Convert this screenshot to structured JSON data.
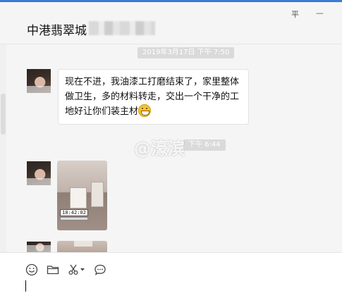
{
  "header": {
    "title": "中港翡翠城",
    "pin_label": "平",
    "minimize_label": "—"
  },
  "messages": [
    {
      "timestamp": "2019年3月17日 下午 7:50",
      "text": "现在不进，我油漆工打磨结束了，家里整体做卫生，多的材料转走，交出一个干净的工地好让你们装主材",
      "emoji": "grin-icon"
    },
    {
      "timestamp": "下午 6:44",
      "photo_clock": "18:42:02"
    }
  ],
  "watermark": "@濠滨",
  "toolbar": {
    "icons": [
      "emoji-icon",
      "folder-icon",
      "scissors-icon",
      "chevron-down-icon",
      "chat-bubble-icon"
    ]
  },
  "colors": {
    "accent": "#3b7bd6",
    "timestamp_bg": "#dadada",
    "emoji": "#f7c52b"
  }
}
